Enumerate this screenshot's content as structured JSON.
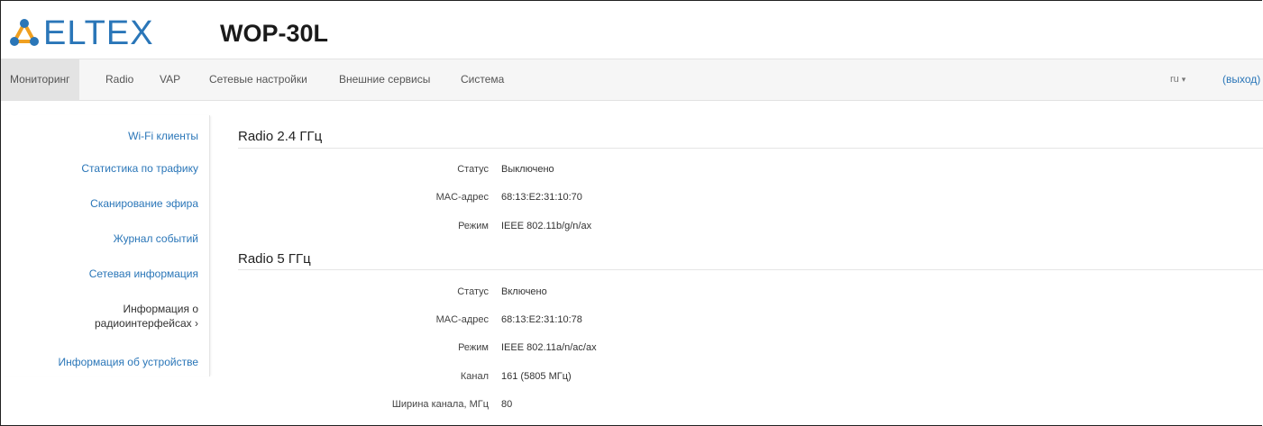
{
  "header": {
    "logo_text": "ELTEX",
    "model": "WOP-30L"
  },
  "navbar": {
    "items": [
      {
        "label": "Мониторинг"
      },
      {
        "label": "Radio"
      },
      {
        "label": "VAP"
      },
      {
        "label": "Сетевые настройки"
      },
      {
        "label": "Внешние сервисы"
      },
      {
        "label": "Система"
      }
    ],
    "lang": "ru",
    "logout": "(выход)"
  },
  "sidebar": {
    "items": [
      {
        "label": "Wi-Fi клиенты"
      },
      {
        "label": "Статистика по трафику"
      },
      {
        "label": "Сканирование эфира"
      },
      {
        "label": "Журнал событий"
      },
      {
        "label": "Сетевая информация"
      },
      {
        "label_line1": "Информация о",
        "label_line2": "радиоинтерфейсах ›"
      },
      {
        "label": "Информация об устройстве"
      }
    ]
  },
  "radio24": {
    "title": "Radio 2.4 ГГц",
    "rows": [
      {
        "label": "Статус",
        "value": "Выключено"
      },
      {
        "label": "MAC-адрес",
        "value": "68:13:E2:31:10:70"
      },
      {
        "label": "Режим",
        "value": "IEEE 802.11b/g/n/ax"
      }
    ]
  },
  "radio5": {
    "title": "Radio 5 ГГц",
    "rows": [
      {
        "label": "Статус",
        "value": "Включено"
      },
      {
        "label": "MAC-адрес",
        "value": "68:13:E2:31:10:78"
      },
      {
        "label": "Режим",
        "value": "IEEE 802.11a/n/ac/ax"
      },
      {
        "label": "Канал",
        "value": "161 (5805 МГц)"
      },
      {
        "label": "Ширина канала, МГц",
        "value": "80"
      }
    ]
  }
}
